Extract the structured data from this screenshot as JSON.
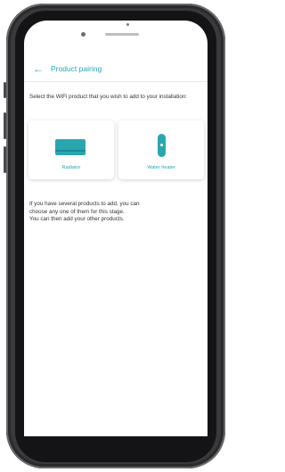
{
  "header": {
    "back_icon": "arrow-left-icon",
    "title": "Product pairing"
  },
  "main": {
    "prompt": "Select the WiFi product that you wish to add to your installation:",
    "products": [
      {
        "label": "Radiator",
        "icon": "radiator-icon"
      },
      {
        "label": "Water heater",
        "icon": "water-heater-icon"
      }
    ],
    "info_lines": [
      "If you have several products to add, you can",
      "choose any one of them for this stage.",
      "You can then add your other products."
    ]
  },
  "colors": {
    "accent": "#2aa6b0",
    "text": "#333333"
  }
}
